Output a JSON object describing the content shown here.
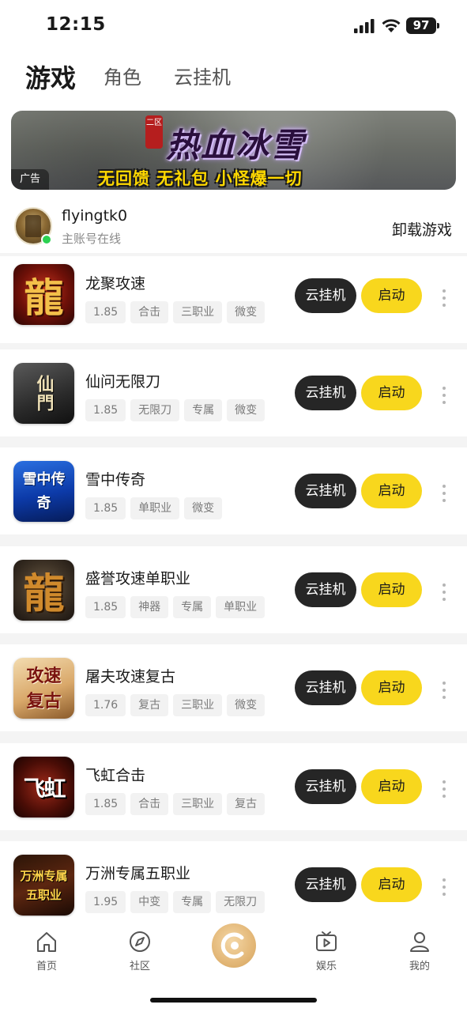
{
  "status_bar": {
    "time": "12:15",
    "battery": "97"
  },
  "tabs": [
    {
      "label": "游戏",
      "active": true
    },
    {
      "label": "角色",
      "active": false
    },
    {
      "label": "云挂机",
      "active": false
    }
  ],
  "banner": {
    "seal": "二区",
    "title": "热血冰雪",
    "slogan": "无回馈 无礼包 小怪爆一切",
    "ad_label": "广告"
  },
  "account": {
    "name": "flyingtk0",
    "status": "主账号在线",
    "uninstall_label": "卸载游戏"
  },
  "buttons": {
    "cloud_label": "云挂机",
    "launch_label": "启动"
  },
  "games": [
    {
      "name": "龙聚攻速",
      "icon_text": "龍",
      "tags": [
        "1.85",
        "合击",
        "三职业",
        "微变"
      ]
    },
    {
      "name": "仙问无限刀",
      "icon_text": "仙門",
      "tags": [
        "1.85",
        "无限刀",
        "专属",
        "微变"
      ]
    },
    {
      "name": "雪中传奇",
      "icon_text": "雪中传奇",
      "tags": [
        "1.85",
        "单职业",
        "微变"
      ]
    },
    {
      "name": "盛誉攻速单职业",
      "icon_text": "龍",
      "tags": [
        "1.85",
        "神器",
        "专属",
        "单职业"
      ]
    },
    {
      "name": "屠夫攻速复古",
      "icon_text": "攻速复古",
      "tags": [
        "1.76",
        "复古",
        "三职业",
        "微变"
      ]
    },
    {
      "name": "飞虹合击",
      "icon_text": "飞虹",
      "tags": [
        "1.85",
        "合击",
        "三职业",
        "复古"
      ]
    },
    {
      "name": "万洲专属五职业",
      "icon_text": "万洲专属五职业",
      "tags": [
        "1.95",
        "中变",
        "专属",
        "无限刀"
      ]
    }
  ],
  "tabbar": [
    {
      "label": "首页",
      "icon": "home-icon"
    },
    {
      "label": "社区",
      "icon": "compass-icon"
    },
    {
      "label": "",
      "icon": "center-logo-icon"
    },
    {
      "label": "娱乐",
      "icon": "tv-play-icon"
    },
    {
      "label": "我的",
      "icon": "user-icon"
    }
  ],
  "colors": {
    "accent_yellow": "#f8d71d",
    "button_dark": "#262626",
    "online_green": "#2bd151",
    "page_bg": "#f4f4f4"
  }
}
